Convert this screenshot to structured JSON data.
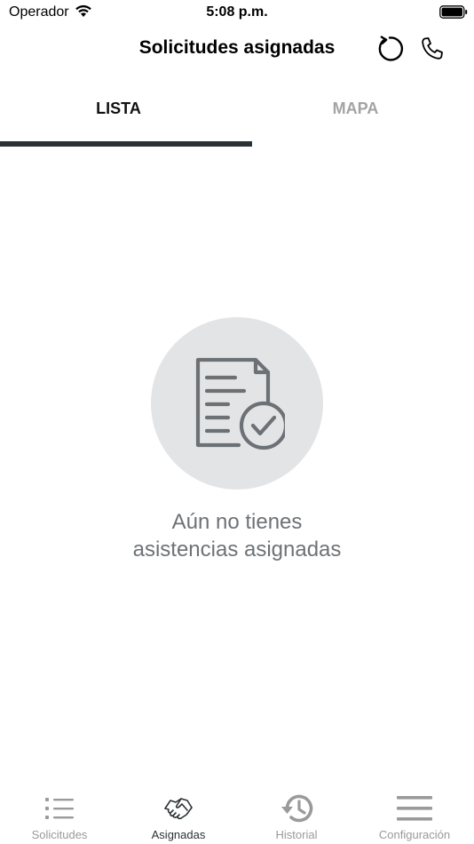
{
  "status_bar": {
    "carrier": "Operador",
    "time": "5:08 p.m.",
    "wifi_icon": "wifi-icon",
    "battery_icon": "battery-icon"
  },
  "nav": {
    "title": "Solicitudes asignadas",
    "refresh_icon": "refresh-icon",
    "phone_icon": "phone-icon"
  },
  "tabs": [
    {
      "label": "LISTA",
      "active": true
    },
    {
      "label": "MAPA",
      "active": false
    }
  ],
  "empty_state": {
    "icon": "document-check-icon",
    "line1": "Aún no tienes",
    "line2": "asistencias asignadas"
  },
  "tabbar": [
    {
      "label": "Solicitudes",
      "icon": "list-icon",
      "active": false
    },
    {
      "label": "Asignadas",
      "icon": "handshake-icon",
      "active": true
    },
    {
      "label": "Historial",
      "icon": "history-icon",
      "active": false
    },
    {
      "label": "Configuración",
      "icon": "menu-icon",
      "active": false
    }
  ],
  "colors": {
    "active_indicator": "#2b3236",
    "inactive_tab": "#a3a3a3",
    "empty_circle": "#e3e4e5",
    "empty_text": "#6e7276",
    "icon_gray": "#6c7176"
  }
}
